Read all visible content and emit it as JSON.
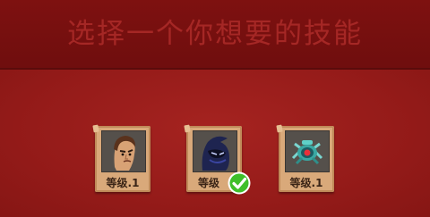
{
  "header": {
    "title": "选择一个你想要的技能"
  },
  "skills": [
    {
      "icon": "human-face-portrait-icon",
      "level_label": "等级.1",
      "selected": false
    },
    {
      "icon": "hooded-ninja-portrait-icon",
      "level_label": "等级",
      "selected": true
    },
    {
      "icon": "mech-spider-robot-icon",
      "level_label": "等级.1",
      "selected": false
    }
  ],
  "colors": {
    "header_bg": "#7e1110",
    "title_text": "#a52725",
    "background": "#9b1e1b",
    "card_frame": "#d9a97a",
    "check_green": "#3fbf2a"
  }
}
